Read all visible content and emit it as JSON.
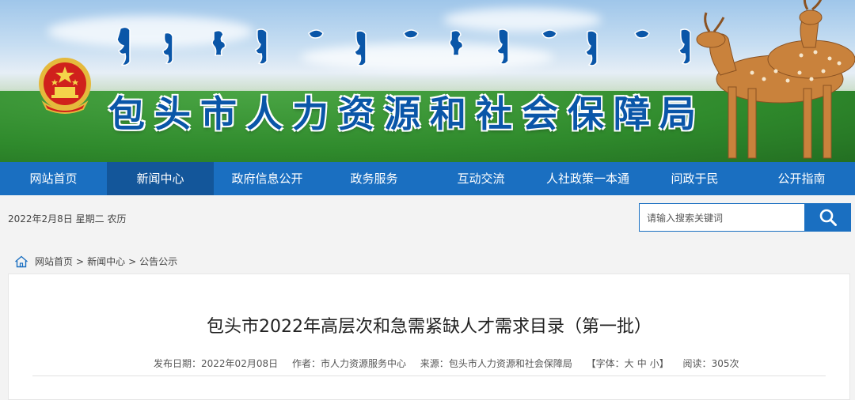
{
  "header": {
    "site_title": "包头市人力资源和社会保障局"
  },
  "nav": {
    "items": [
      {
        "label": "网站首页"
      },
      {
        "label": "新闻中心"
      },
      {
        "label": "政府信息公开"
      },
      {
        "label": "政务服务"
      },
      {
        "label": "互动交流"
      },
      {
        "label": "人社政策一本通"
      },
      {
        "label": "问政于民"
      },
      {
        "label": "公开指南"
      }
    ],
    "active_index": 1
  },
  "infobar": {
    "date_text": "2022年2月8日 星期二 农历",
    "search_placeholder": "请输入搜索关键词"
  },
  "breadcrumb": {
    "items": [
      "网站首页",
      "新闻中心",
      "公告公示"
    ],
    "separator": ">"
  },
  "article": {
    "title": "包头市2022年高层次和急需紧缺人才需求目录（第一批）",
    "publish_label": "发布日期：",
    "publish_date": "2022年02月08日",
    "author_label": "作者：",
    "author": "市人力资源服务中心",
    "source_label": "来源：",
    "source": "包头市人力资源和社会保障局",
    "font_label": "【字体：",
    "font_large": "大",
    "font_medium": "中",
    "font_small": "小】",
    "reads_label": "阅读：",
    "reads": "305次"
  },
  "colors": {
    "nav_bg": "#1a6fc1",
    "nav_active": "#13569a",
    "title_blue": "#0a56a8"
  }
}
